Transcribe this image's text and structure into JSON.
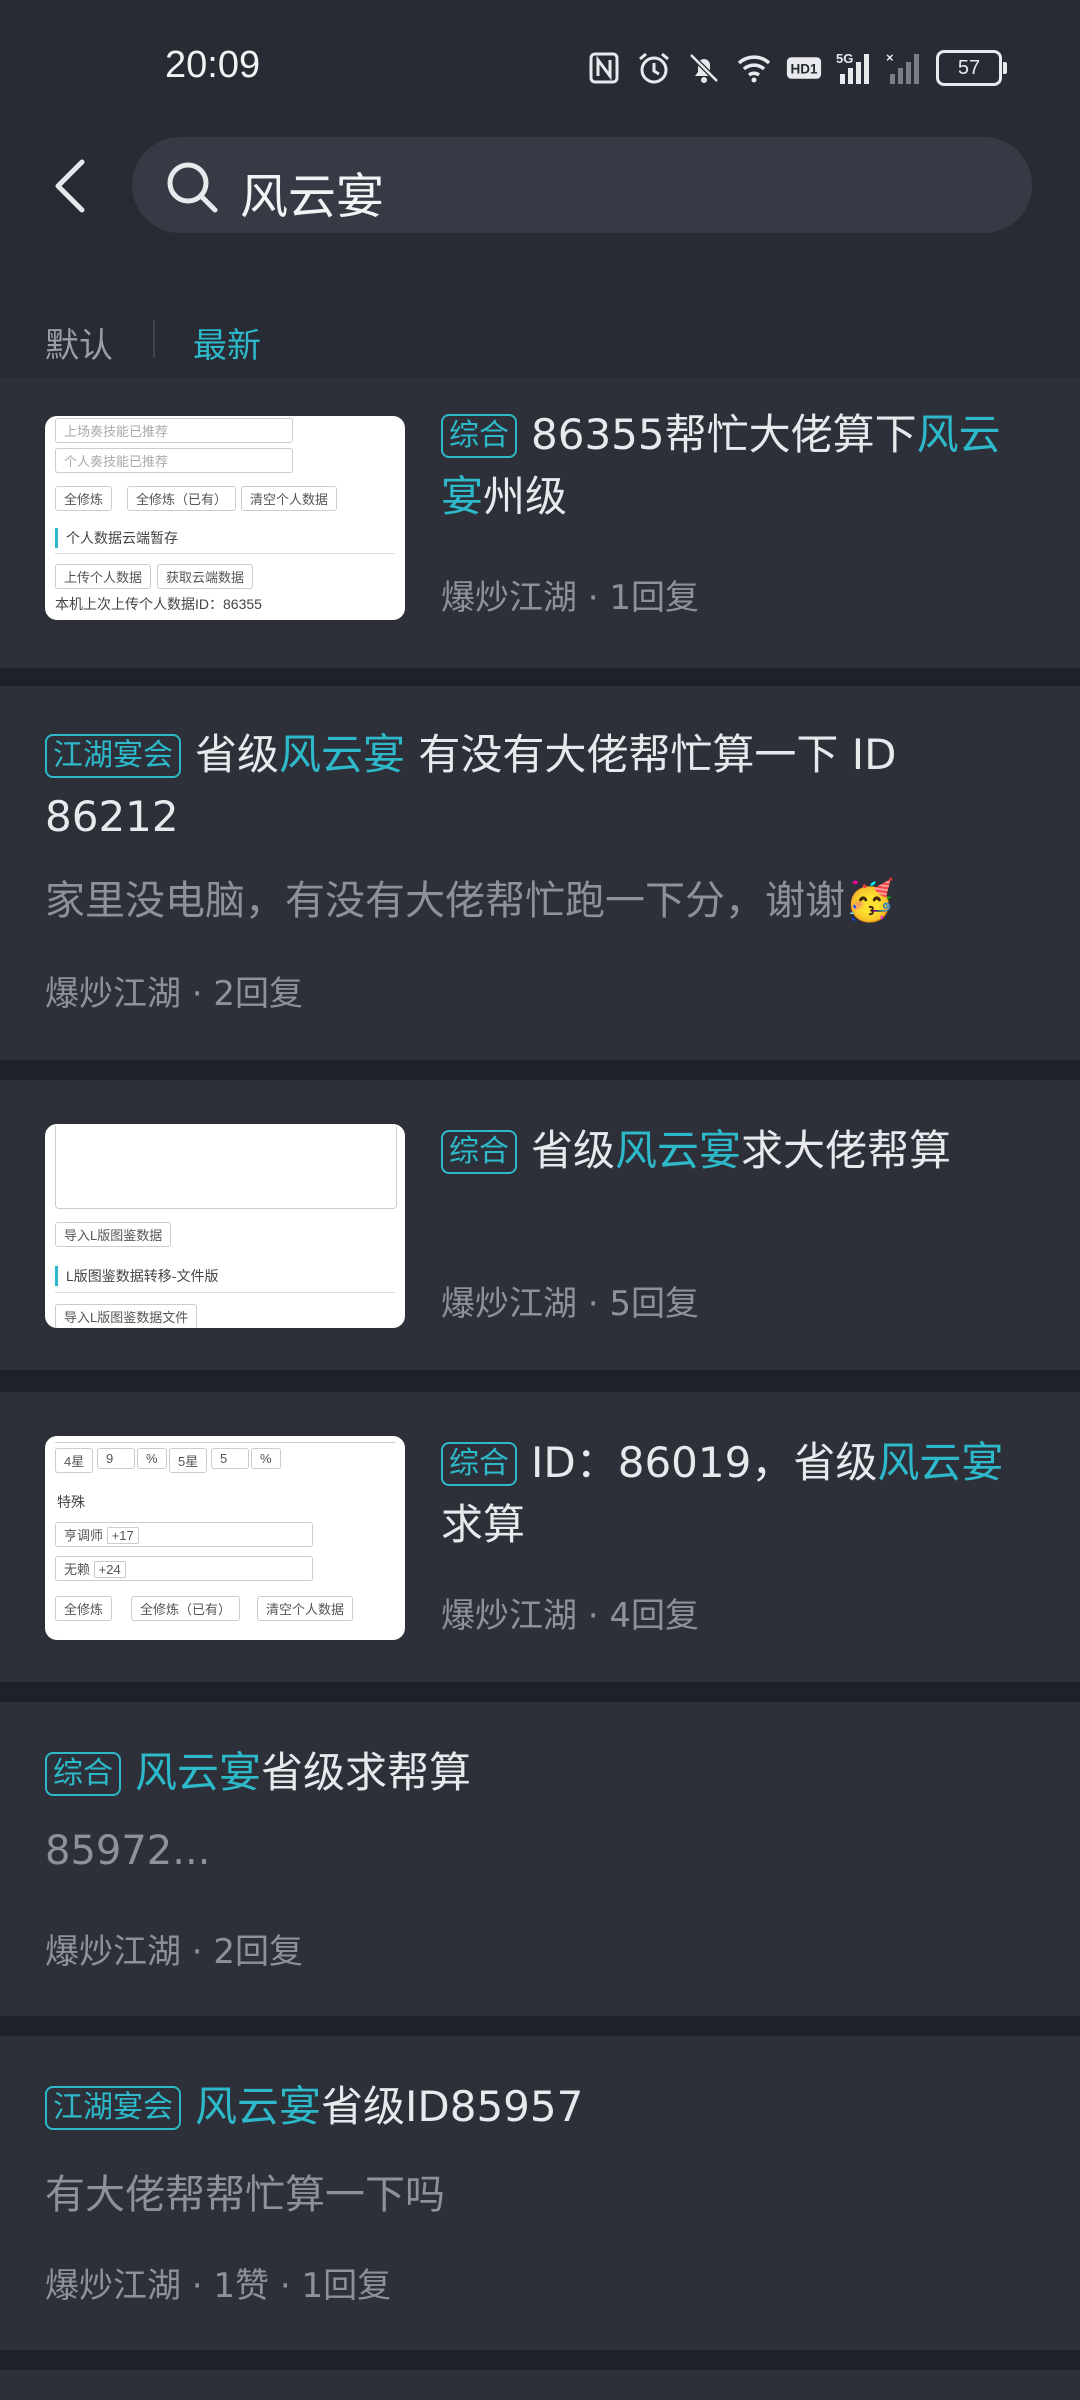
{
  "status_bar": {
    "time": "20:09",
    "battery": "57"
  },
  "search": {
    "query": "风云宴"
  },
  "tabs": [
    {
      "label": "默认"
    },
    {
      "label": "最新"
    }
  ],
  "posts": [
    {
      "tag": "综合",
      "title_before": "86355帮忙大佬算下",
      "title_highlight": "风云宴",
      "title_after": "州级",
      "meta": "爆炒江湖 · 1回复",
      "thumb": {
        "row1": "上场奏技能已推荐",
        "row2": "个人奏技能已推荐",
        "b1": "全修炼",
        "b2": "全修炼（已有）",
        "b3": "清空个人数据",
        "section": "个人数据云端暂存",
        "b4": "上传个人数据",
        "b5": "获取云端数据",
        "foot": "本机上次上传个人数据ID：86355"
      }
    },
    {
      "tag": "江湖宴会",
      "title_before": "省级",
      "title_highlight": "风云宴",
      "title_after": " 有没有大佬帮忙算一下 ID 86212",
      "desc": "家里没电脑，有没有大佬帮忙跑一下分，谢谢🥳",
      "meta": "爆炒江湖 · 2回复"
    },
    {
      "tag": "综合",
      "title_before": "省级",
      "title_highlight": "风云宴",
      "title_after": "求大佬帮算",
      "meta": "爆炒江湖 · 5回复",
      "thumb": {
        "b1": "导入L版图鉴数据",
        "section": "L版图鉴数据转移-文件版",
        "b2": "导入L版图鉴数据文件"
      }
    },
    {
      "tag": "综合",
      "title_before": "ID：86019，省级",
      "title_highlight": "风云宴",
      "title_after": "求算",
      "meta": "爆炒江湖 · 4回复",
      "thumb": {
        "c1": "4星",
        "c2": "9",
        "c3": "%",
        "c4": "5星",
        "c5": "5",
        "c6": "%",
        "section": "特殊",
        "s1": "亨调师",
        "s1b": "+17",
        "s2": "无赖",
        "s2b": "+24",
        "b1": "全修炼",
        "b2": "全修炼（已有）",
        "b3": "清空个人数据"
      }
    },
    {
      "tag": "综合",
      "title_before": "",
      "title_highlight": "风云宴",
      "title_after": "省级求帮算",
      "desc": "85972...",
      "meta": "爆炒江湖 · 2回复"
    },
    {
      "tag": "江湖宴会",
      "title_before": "",
      "title_highlight": "风云宴",
      "title_after": "省级ID85957",
      "desc": "有大佬帮帮忙算一下吗",
      "meta": "爆炒江湖 · 1赞 · 1回复"
    }
  ],
  "colors": {
    "accent": "#2db9c9",
    "background": "#1f2129",
    "card": "#2d3039"
  },
  "icons": [
    "nfc-icon",
    "alarm-icon",
    "mute-icon",
    "wifi-icon",
    "hd-icon",
    "signal-5g-icon",
    "signal-icon",
    "back-arrow-icon",
    "search-icon"
  ]
}
